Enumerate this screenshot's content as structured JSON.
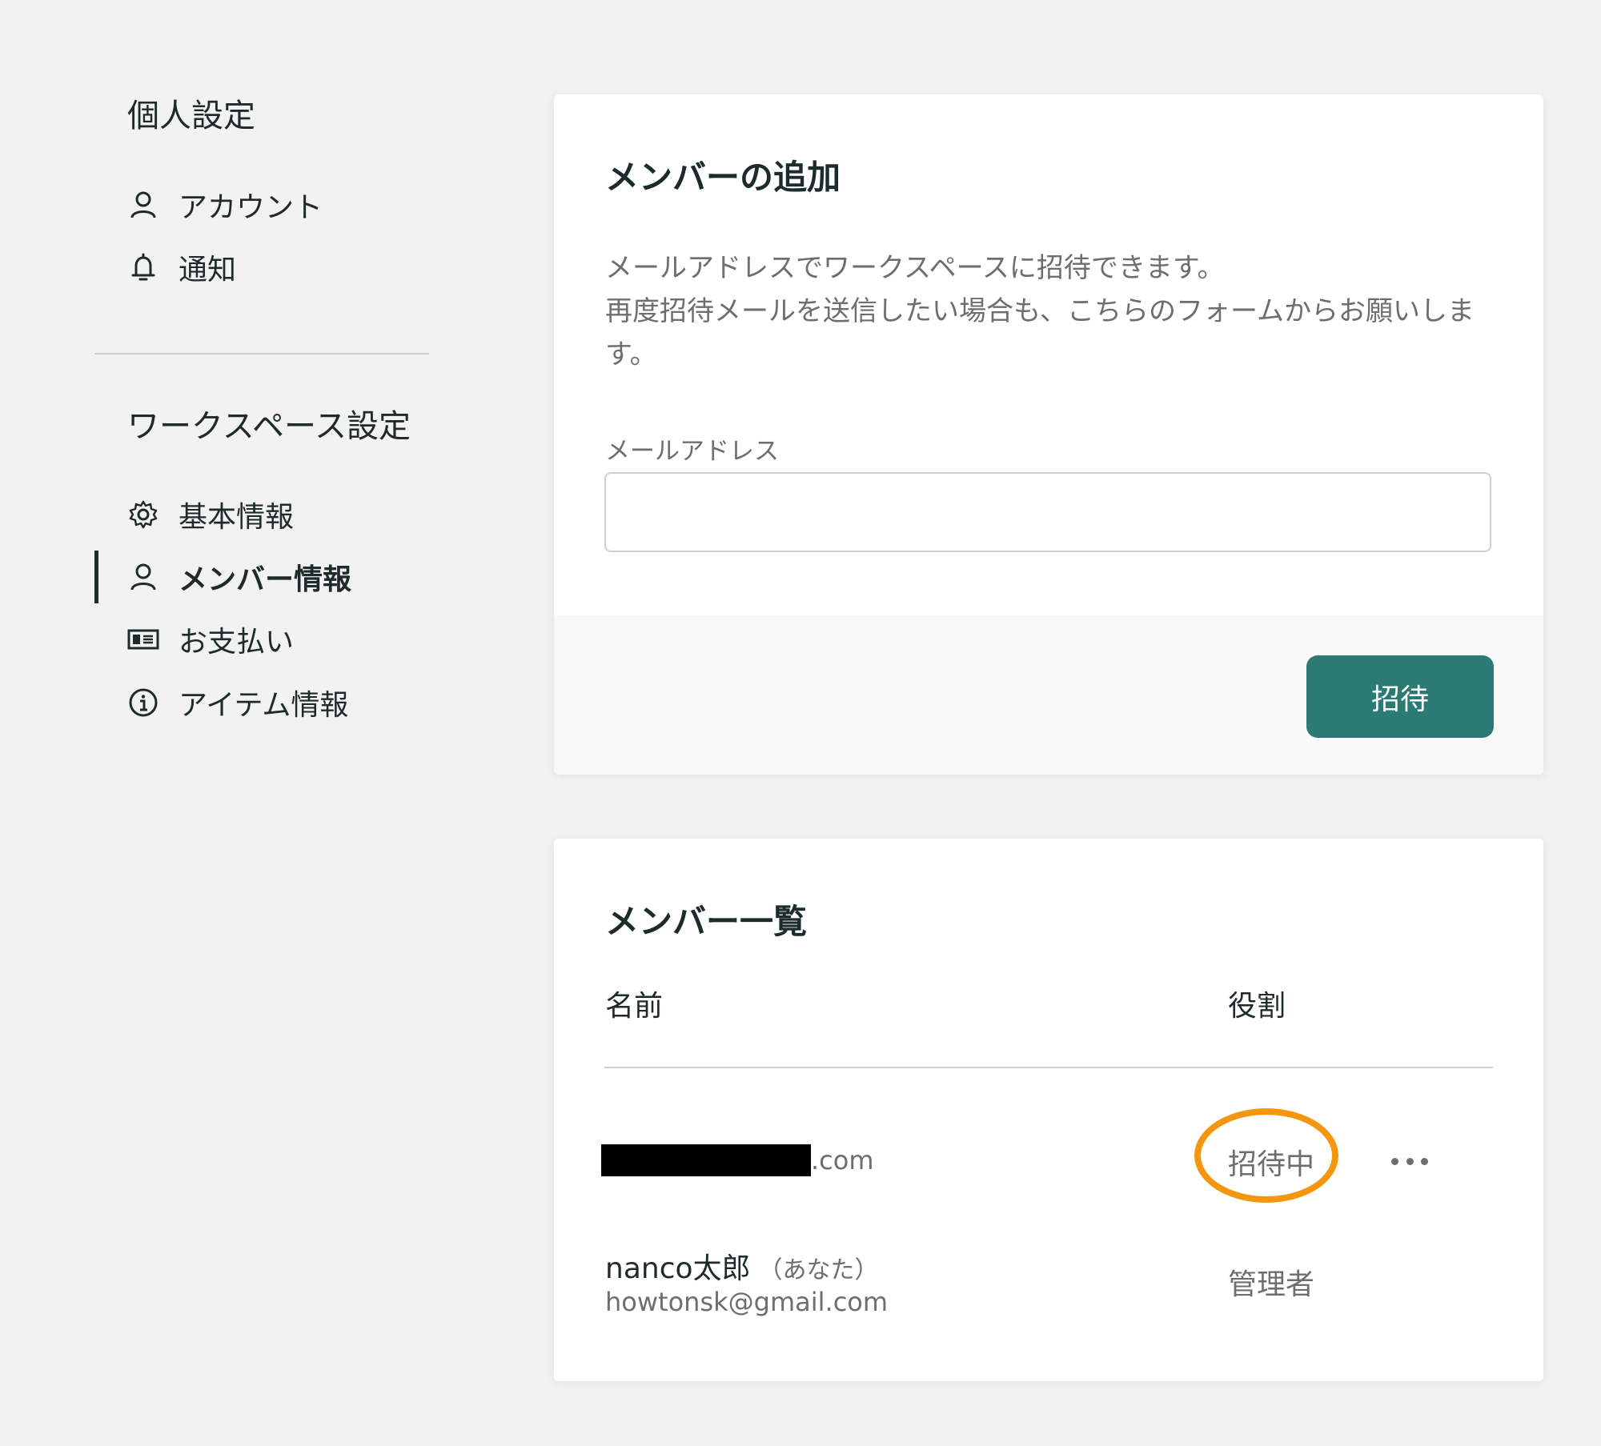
{
  "sidebar": {
    "personal_title": "個人設定",
    "personal_items": [
      {
        "label": "アカウント",
        "icon": "user-icon"
      },
      {
        "label": "通知",
        "icon": "bell-icon"
      }
    ],
    "workspace_title": "ワークスペース設定",
    "workspace_items": [
      {
        "label": "基本情報",
        "icon": "gear-icon"
      },
      {
        "label": "メンバー情報",
        "icon": "user-icon",
        "active": true
      },
      {
        "label": "お支払い",
        "icon": "card-icon"
      },
      {
        "label": "アイテム情報",
        "icon": "info-icon"
      }
    ]
  },
  "add_member": {
    "title": "メンバーの追加",
    "description_line1": "メールアドレスでワークスペースに招待できます。",
    "description_line2": "再度招待メールを送信したい場合も、こちらのフォームからお願いします。",
    "email_label": "メールアドレス",
    "email_value": "",
    "invite_label": "招待"
  },
  "member_list": {
    "title": "メンバー一覧",
    "col_name": "名前",
    "col_role": "役割",
    "rows": [
      {
        "email_suffix": ".com",
        "role": "招待中"
      },
      {
        "name": "nanco太郎",
        "you_tag": "（あなた）",
        "email": "howtonsk@gmail.com",
        "role": "管理者"
      }
    ]
  },
  "colors": {
    "accent": "#2b7a74",
    "highlight": "#f5960f",
    "background": "#f2f2f2"
  }
}
